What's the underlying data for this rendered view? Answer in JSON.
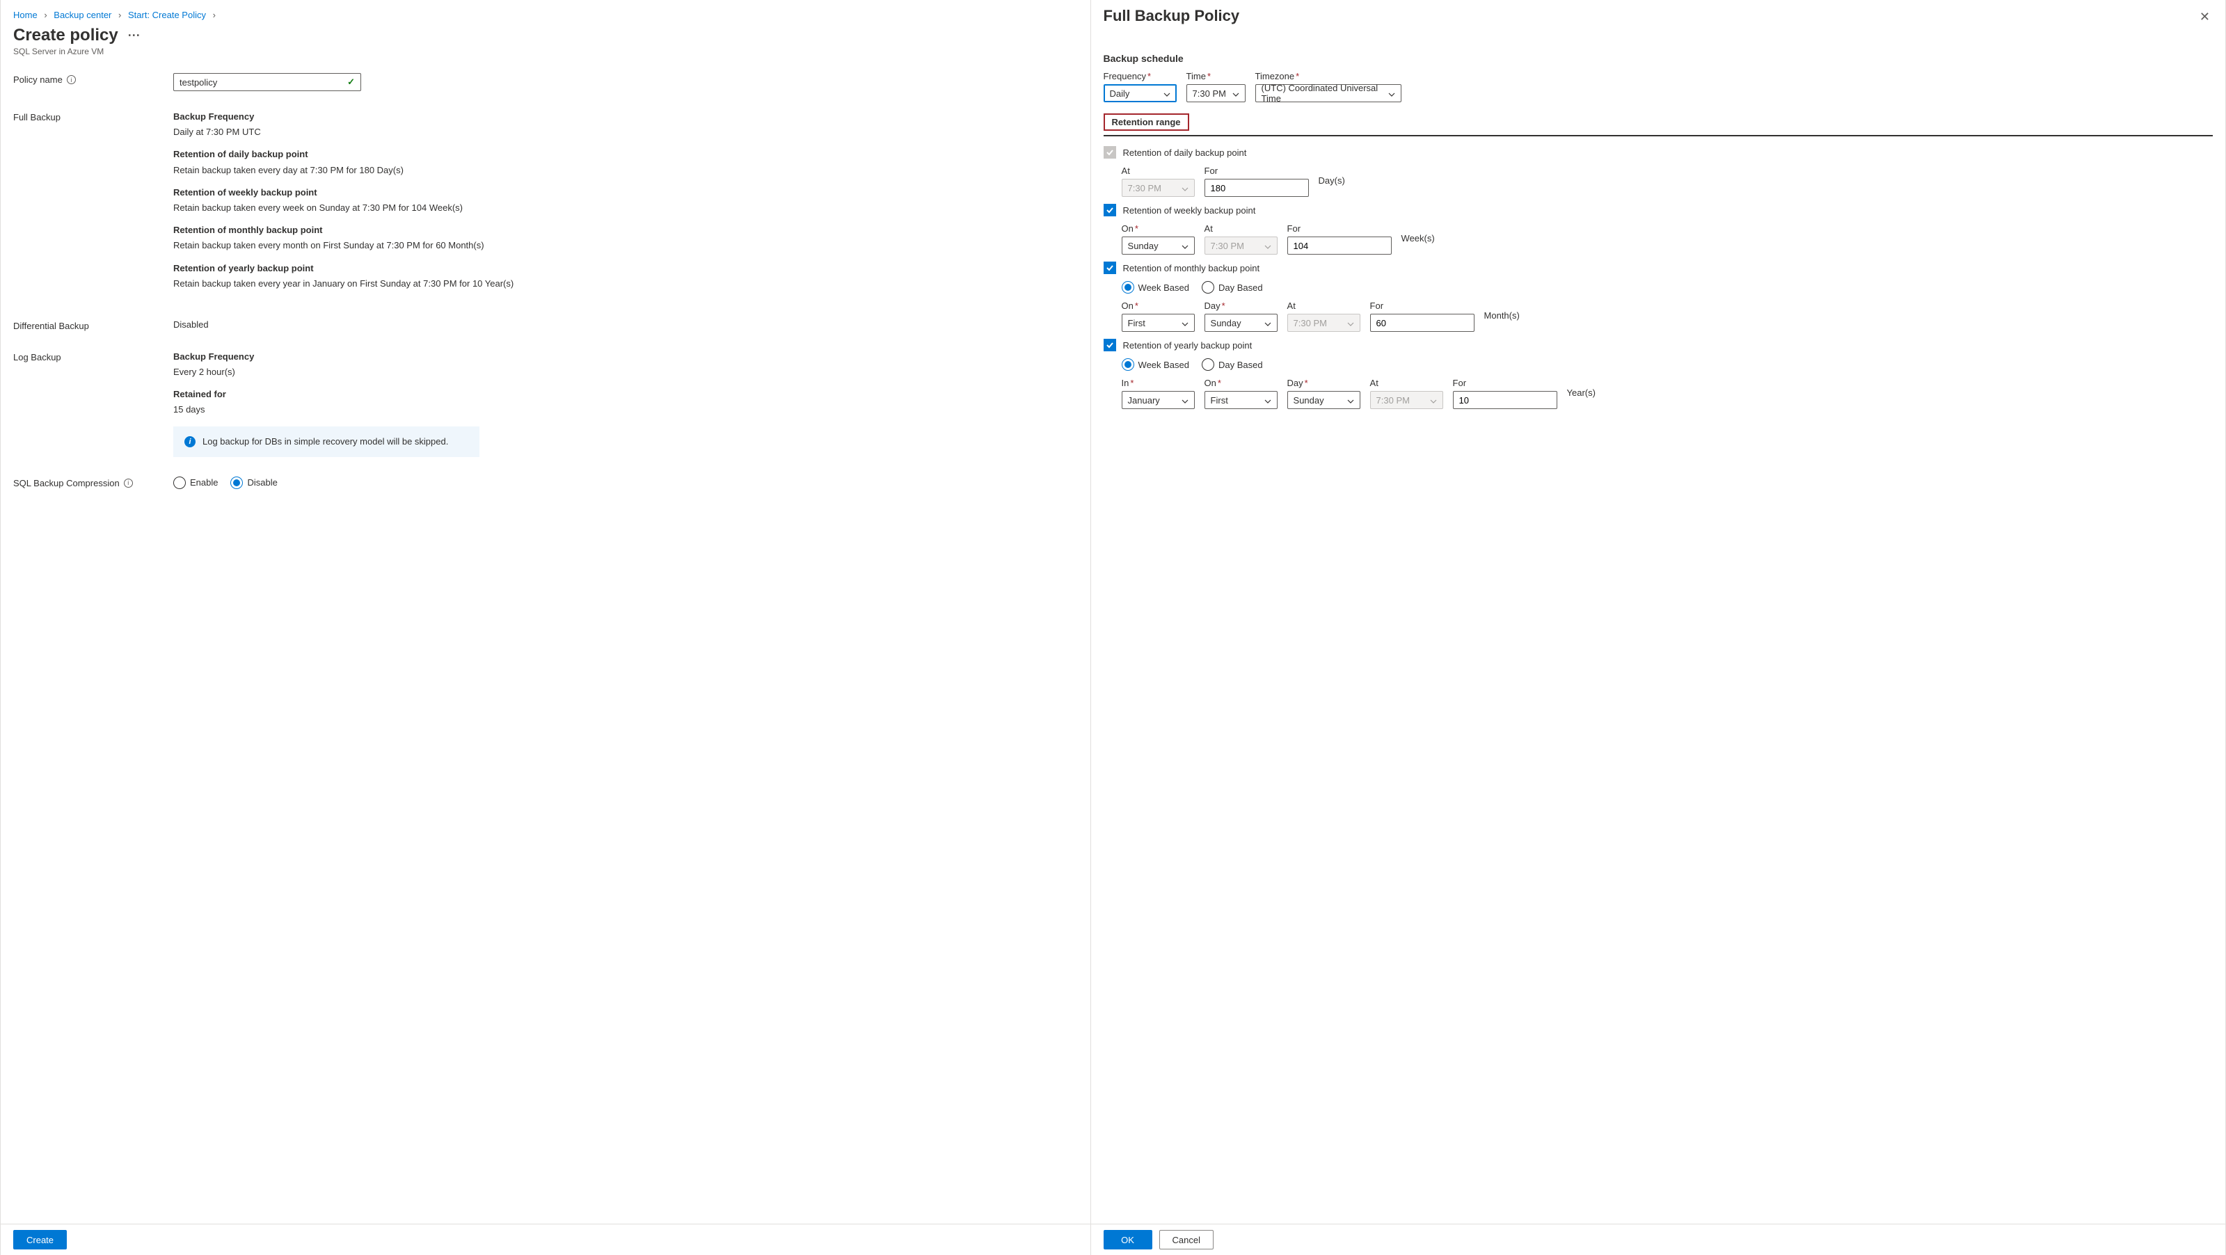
{
  "breadcrumb": {
    "home": "Home",
    "backup_center": "Backup center",
    "start_create": "Start: Create Policy"
  },
  "left": {
    "title": "Create policy",
    "subtitle": "SQL Server in Azure VM",
    "policy_name_label": "Policy name",
    "policy_name_value": "testpolicy",
    "full_backup_label": "Full Backup",
    "full_backup": {
      "freq_title": "Backup Frequency",
      "freq_value": "Daily at 7:30 PM UTC",
      "daily_title": "Retention of daily backup point",
      "daily_value": "Retain backup taken every day at 7:30 PM for 180 Day(s)",
      "weekly_title": "Retention of weekly backup point",
      "weekly_value": "Retain backup taken every week on Sunday at 7:30 PM for 104 Week(s)",
      "monthly_title": "Retention of monthly backup point",
      "monthly_value": "Retain backup taken every month on First Sunday at 7:30 PM for 60 Month(s)",
      "yearly_title": "Retention of yearly backup point",
      "yearly_value": "Retain backup taken every year in January on First Sunday at 7:30 PM for 10 Year(s)"
    },
    "diff_label": "Differential Backup",
    "diff_value": "Disabled",
    "log_label": "Log Backup",
    "log": {
      "freq_title": "Backup Frequency",
      "freq_value": "Every 2 hour(s)",
      "ret_title": "Retained for",
      "ret_value": "15 days",
      "callout": "Log backup for DBs in simple recovery model will be skipped."
    },
    "compression_label": "SQL Backup Compression",
    "compression_enable": "Enable",
    "compression_disable": "Disable",
    "create_btn": "Create"
  },
  "right": {
    "title": "Full Backup Policy",
    "backup_schedule_title": "Backup schedule",
    "frequency_label": "Frequency",
    "frequency_value": "Daily",
    "time_label": "Time",
    "time_value": "7:30 PM",
    "timezone_label": "Timezone",
    "timezone_value": "(UTC) Coordinated Universal Time",
    "retention_title": "Retention range",
    "daily": {
      "label": "Retention of daily backup point",
      "at_label": "At",
      "at_value": "7:30 PM",
      "for_label": "For",
      "for_value": "180",
      "unit": "Day(s)"
    },
    "weekly": {
      "label": "Retention of weekly backup point",
      "on_label": "On",
      "on_value": "Sunday",
      "at_label": "At",
      "at_value": "7:30 PM",
      "for_label": "For",
      "for_value": "104",
      "unit": "Week(s)"
    },
    "monthly": {
      "label": "Retention of monthly backup point",
      "week_based": "Week Based",
      "day_based": "Day Based",
      "on_label": "On",
      "on_value": "First",
      "day_label": "Day",
      "day_value": "Sunday",
      "at_label": "At",
      "at_value": "7:30 PM",
      "for_label": "For",
      "for_value": "60",
      "unit": "Month(s)"
    },
    "yearly": {
      "label": "Retention of yearly backup point",
      "week_based": "Week Based",
      "day_based": "Day Based",
      "in_label": "In",
      "in_value": "January",
      "on_label": "On",
      "on_value": "First",
      "day_label": "Day",
      "day_value": "Sunday",
      "at_label": "At",
      "at_value": "7:30 PM",
      "for_label": "For",
      "for_value": "10",
      "unit": "Year(s)"
    },
    "ok_btn": "OK",
    "cancel_btn": "Cancel"
  }
}
